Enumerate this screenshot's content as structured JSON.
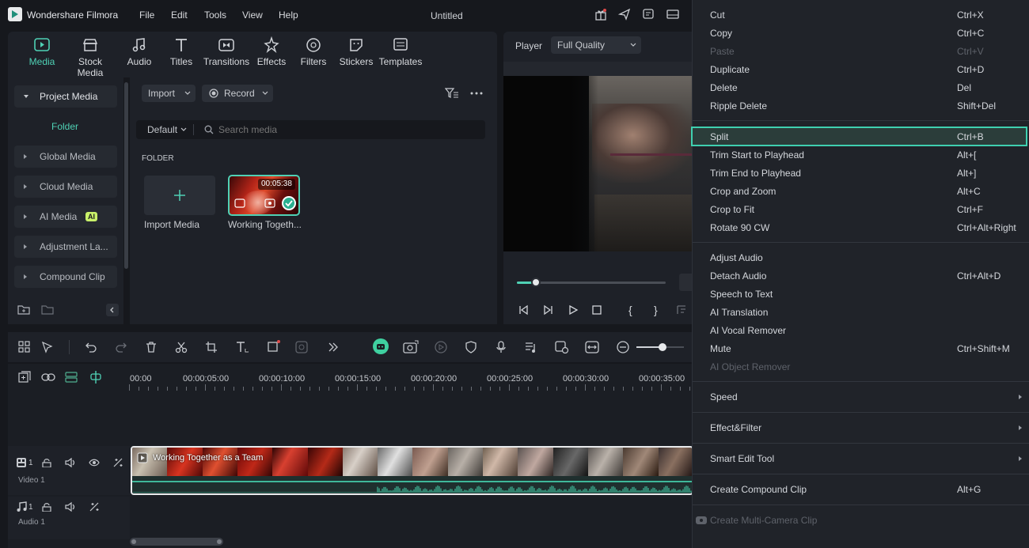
{
  "app": {
    "name": "Wondershare Filmora",
    "document_title": "Untitled"
  },
  "menubar": [
    "File",
    "Edit",
    "Tools",
    "View",
    "Help"
  ],
  "media_tabs": [
    {
      "label": "Media",
      "icon": "media-icon",
      "active": true
    },
    {
      "label": "Stock Media",
      "icon": "stock-media-icon"
    },
    {
      "label": "Audio",
      "icon": "audio-note-icon"
    },
    {
      "label": "Titles",
      "icon": "titles-icon"
    },
    {
      "label": "Transitions",
      "icon": "transitions-icon"
    },
    {
      "label": "Effects",
      "icon": "effects-icon"
    },
    {
      "label": "Filters",
      "icon": "filters-icon"
    },
    {
      "label": "Stickers",
      "icon": "stickers-icon"
    },
    {
      "label": "Templates",
      "icon": "templates-icon"
    }
  ],
  "sidebar": {
    "items": [
      {
        "label": "Project Media"
      },
      {
        "label": "Folder"
      },
      {
        "label": "Global Media"
      },
      {
        "label": "Cloud Media"
      },
      {
        "label": "AI Media",
        "badge": "AI"
      },
      {
        "label": "Adjustment La..."
      },
      {
        "label": "Compound Clip"
      }
    ]
  },
  "media": {
    "import_label": "Import",
    "record_label": "Record",
    "sort_label": "Default",
    "search_placeholder": "Search media",
    "folder_heading": "FOLDER",
    "items": [
      {
        "label": "Import Media"
      },
      {
        "label": "Working Togeth...",
        "duration": "00:05:38"
      }
    ]
  },
  "player": {
    "label": "Player",
    "quality": "Full Quality",
    "progress": 0.13
  },
  "timeline": {
    "ruler": [
      "00:00",
      "00:00:05:00",
      "00:00:10:00",
      "00:00:15:00",
      "00:00:20:00",
      "00:00:25:00",
      "00:00:30:00",
      "00:00:35:00"
    ],
    "video_track": {
      "label": "Video 1",
      "number": "1",
      "clip_title": "Working Together as a Team"
    },
    "audio_track": {
      "label": "Audio 1",
      "number": "1"
    },
    "zoom_level": 0.55
  },
  "context_menu": [
    {
      "label": "Cut",
      "shortcut": "Ctrl+X"
    },
    {
      "label": "Copy",
      "shortcut": "Ctrl+C"
    },
    {
      "label": "Paste",
      "shortcut": "Ctrl+V",
      "disabled": true
    },
    {
      "label": "Duplicate",
      "shortcut": "Ctrl+D"
    },
    {
      "label": "Delete",
      "shortcut": "Del"
    },
    {
      "label": "Ripple Delete",
      "shortcut": "Shift+Del"
    },
    {
      "label": "Split",
      "shortcut": "Ctrl+B",
      "highlighted": true
    },
    {
      "label": "Trim Start to Playhead",
      "shortcut": "Alt+["
    },
    {
      "label": "Trim End to Playhead",
      "shortcut": "Alt+]"
    },
    {
      "label": "Crop and Zoom",
      "shortcut": "Alt+C"
    },
    {
      "label": "Crop to Fit",
      "shortcut": "Ctrl+F"
    },
    {
      "label": "Rotate 90 CW",
      "shortcut": "Ctrl+Alt+Right"
    },
    {
      "label": "Adjust Audio",
      "shortcut": ""
    },
    {
      "label": "Detach Audio",
      "shortcut": "Ctrl+Alt+D"
    },
    {
      "label": "Speech to Text",
      "shortcut": ""
    },
    {
      "label": "AI Translation",
      "shortcut": ""
    },
    {
      "label": "AI Vocal Remover",
      "shortcut": ""
    },
    {
      "label": "Mute",
      "shortcut": "Ctrl+Shift+M"
    },
    {
      "label": "AI Object Remover",
      "shortcut": "",
      "disabled": true
    },
    {
      "label": "Speed",
      "submenu": true
    },
    {
      "label": "Effect&Filter",
      "submenu": true
    },
    {
      "label": "Smart Edit Tool",
      "submenu": true
    },
    {
      "label": "Create Compound Clip",
      "shortcut": "Alt+G"
    },
    {
      "label": "Create Multi-Camera Clip",
      "shortcut": "",
      "disabled": true
    }
  ],
  "colors": {
    "accent": "#4fd1b5",
    "highlight_border": "#3fd0b0",
    "bg": "#16181d",
    "panel": "#1e2128"
  }
}
